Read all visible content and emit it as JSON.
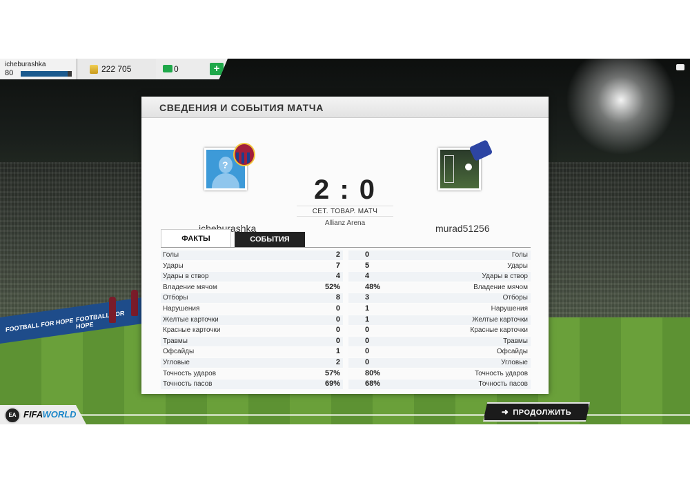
{
  "topbar": {
    "username": "icheburashka",
    "level": "80",
    "level_progress": 0.92,
    "coins": "222 705",
    "fifa_points": "0",
    "add_points_label": "+"
  },
  "panel": {
    "title": "СВЕДЕНИЯ И СОБЫТИЯ МАТЧА",
    "home_team": "icheburashka",
    "away_team": "murad51256",
    "home_avatar_glyph": "?",
    "score": "2 : 0",
    "match_type": "СЕТ. ТОВАР. МАТЧ",
    "venue": "Allianz Arena",
    "tabs": [
      "ФАКТЫ",
      "СОБЫТИЯ"
    ]
  },
  "stats": [
    {
      "label": "Голы",
      "home": "2",
      "away": "0"
    },
    {
      "label": "Удары",
      "home": "7",
      "away": "5"
    },
    {
      "label": "Удары в створ",
      "home": "4",
      "away": "4"
    },
    {
      "label": "Владение мячом",
      "home": "52%",
      "away": "48%"
    },
    {
      "label": "Отборы",
      "home": "8",
      "away": "3"
    },
    {
      "label": "Нарушения",
      "home": "0",
      "away": "1"
    },
    {
      "label": "Желтые карточки",
      "home": "0",
      "away": "1"
    },
    {
      "label": "Красные карточки",
      "home": "0",
      "away": "0"
    },
    {
      "label": "Травмы",
      "home": "0",
      "away": "0"
    },
    {
      "label": "Офсайды",
      "home": "1",
      "away": "0"
    },
    {
      "label": "Угловые",
      "home": "2",
      "away": "0"
    },
    {
      "label": "Точность ударов",
      "home": "57%",
      "away": "80%"
    },
    {
      "label": "Точность пасов",
      "home": "69%",
      "away": "68%"
    }
  ],
  "footer": {
    "ea_label": "EA SPORTS",
    "brand_fifa": "FIFA",
    "brand_world": "WORLD",
    "continue_label": "ПРОДОЛЖИТЬ"
  },
  "background": {
    "ad_text": "FOOTBALL FOR HOPE"
  },
  "icons": {
    "coin": "coin-icon",
    "points": "fifa-points-icon",
    "camera": "camera-icon",
    "arrow": "arrow-right-icon"
  },
  "colors": {
    "accent_green": "#1fa84a",
    "brand_blue": "#1b86c9",
    "xp_bar": "#1b5a8e"
  }
}
